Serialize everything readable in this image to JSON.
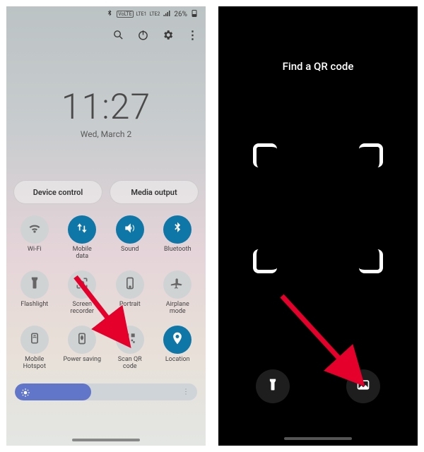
{
  "status": {
    "volte": "VoLTE",
    "lte1": "LTE1",
    "lte2": "LTE2",
    "battery": "26%"
  },
  "clock": {
    "time": "11:27",
    "date": "Wed, March 2"
  },
  "chips": {
    "device_control": "Device control",
    "media_output": "Media output"
  },
  "tiles": [
    {
      "key": "wifi",
      "label": "Wi-Fi",
      "on": false
    },
    {
      "key": "mobiledata",
      "label": "Mobile\ndata",
      "on": true
    },
    {
      "key": "sound",
      "label": "Sound",
      "on": true
    },
    {
      "key": "bluetooth",
      "label": "Bluetooth",
      "on": true
    },
    {
      "key": "flashlight",
      "label": "Flashlight",
      "on": false
    },
    {
      "key": "screenrec",
      "label": "Screen\nrecorder",
      "on": false
    },
    {
      "key": "portrait",
      "label": "Portrait",
      "on": false
    },
    {
      "key": "airplane",
      "label": "Airplane\nmode",
      "on": false
    },
    {
      "key": "hotspot",
      "label": "Mobile\nHotspot",
      "on": false
    },
    {
      "key": "powersaving",
      "label": "Power saving",
      "on": false
    },
    {
      "key": "scanqr",
      "label": "Scan QR\ncode",
      "on": false
    },
    {
      "key": "location",
      "label": "Location",
      "on": true
    }
  ],
  "brightness": {
    "percent": 42
  },
  "right": {
    "title": "Find a QR code"
  }
}
